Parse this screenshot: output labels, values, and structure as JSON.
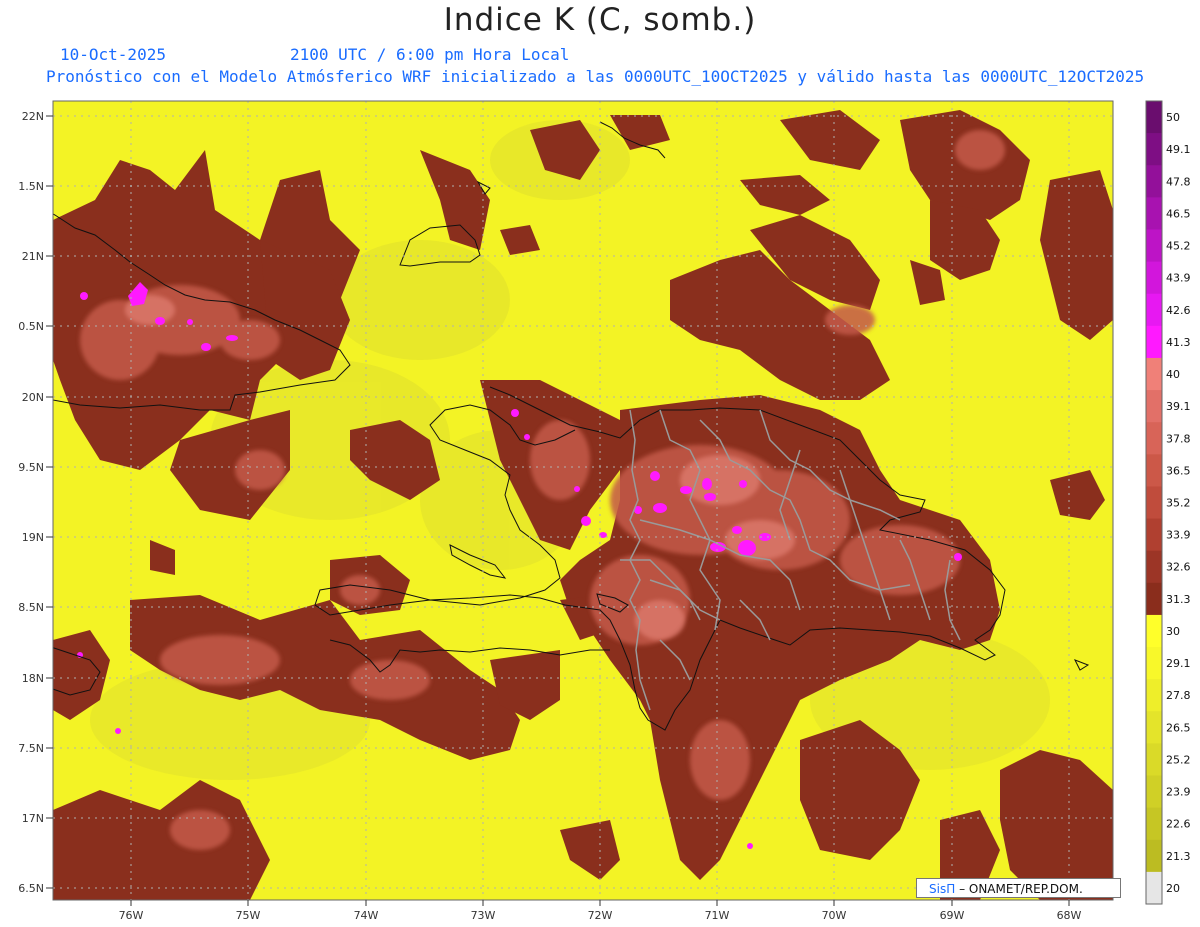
{
  "header": {
    "title": "Indice K (C, somb.)",
    "date": "10-Oct-2025",
    "time": "2100 UTC / 6:00 pm Hora Local",
    "description": "Pronóstico con el Modelo Atmósferico WRF inicializado a las 0000UTC_10OCT2025 y válido hasta las  0000UTC_12OCT2025"
  },
  "map": {
    "lat_labels": [
      "22N",
      "1.5N",
      "21N",
      "0.5N",
      "20N",
      "9.5N",
      "19N",
      "8.5N",
      "18N",
      "7.5N",
      "17N",
      "6.5N"
    ],
    "lon_labels": [
      "76W",
      "75W",
      "74W",
      "73W",
      "72W",
      "71W",
      "70W",
      "69W",
      "68W"
    ],
    "grid": true,
    "region": "Hispaniola and surrounding Caribbean"
  },
  "colorbar": {
    "labels": [
      "50",
      "49.1",
      "47.8",
      "46.5",
      "45.2",
      "43.9",
      "42.6",
      "41.3",
      "40",
      "39.1",
      "37.8",
      "36.5",
      "35.2",
      "33.9",
      "32.6",
      "31.3",
      "30",
      "29.1",
      "27.8",
      "26.5",
      "25.2",
      "23.9",
      "22.6",
      "21.3",
      "20"
    ],
    "colors": [
      "#6a0d6e",
      "#7e0e84",
      "#93109a",
      "#a812b0",
      "#bd14c6",
      "#d216dc",
      "#e718f2",
      "#ff19ff",
      "#f08078",
      "#e27068",
      "#d86458",
      "#cc5848",
      "#c04c3c",
      "#b04030",
      "#9c3526",
      "#8a2d1c",
      "#ffff2a",
      "#f8f82a",
      "#eeee2a",
      "#e4e42a",
      "#dada28",
      "#d0d026",
      "#c6c624",
      "#bcbc22",
      "#e6e6e6"
    ]
  },
  "credit": {
    "brand": "SisΠ",
    "text": "– ONAMET/REP.DOM."
  }
}
